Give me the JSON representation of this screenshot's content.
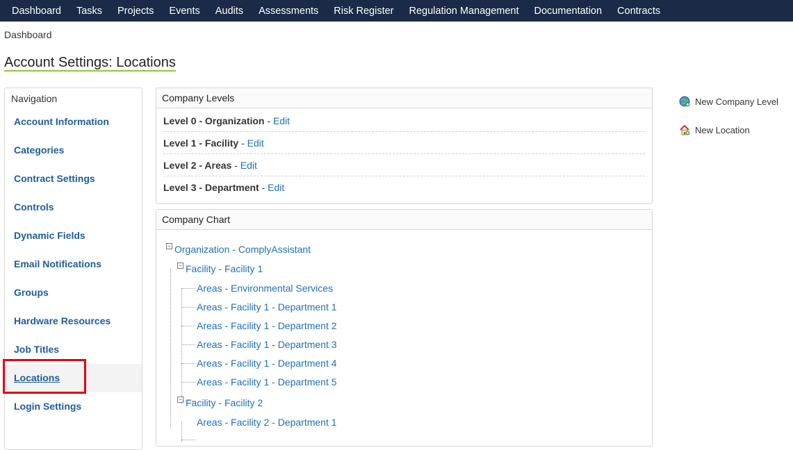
{
  "topnav": [
    "Dashboard",
    "Tasks",
    "Projects",
    "Events",
    "Audits",
    "Assessments",
    "Risk Register",
    "Regulation Management",
    "Documentation",
    "Contracts"
  ],
  "breadcrumb": "Dashboard",
  "page_title": "Account Settings: Locations",
  "sidenav": {
    "heading": "Navigation",
    "items": [
      "Account Information",
      "Categories",
      "Contract Settings",
      "Controls",
      "Dynamic Fields",
      "Email Notifications",
      "Groups",
      "Hardware Resources",
      "Job Titles",
      "Locations",
      "Login Settings"
    ],
    "active": "Locations"
  },
  "levels": {
    "heading": "Company Levels",
    "edit_label": "Edit",
    "separator": "-",
    "rows": [
      "Level 0 - Organization",
      "Level 1 - Facility",
      "Level 2 - Areas",
      "Level 3 - Department"
    ]
  },
  "chart": {
    "heading": "Company Chart",
    "toggle_glyph": "−",
    "nodes": {
      "org": "Organization - ComplyAssistant",
      "fac1": "Facility - Facility 1",
      "fac1_children": [
        "Areas - Environmental Services",
        "Areas - Facility 1 - Department 1",
        "Areas - Facility 1 - Department 2",
        "Areas - Facility 1 - Department 3",
        "Areas - Facility 1 - Department 4",
        "Areas - Facility 1 - Department 5"
      ],
      "fac2": "Facility - Facility 2",
      "fac2_children": [
        "Areas - Facility 2 - Department 1"
      ]
    }
  },
  "actions": {
    "new_level": "New Company Level",
    "new_location": "New Location"
  },
  "colors": {
    "topnav_bg": "#1b2a47",
    "link": "#1f6fb8",
    "nav_link": "#1f5c99",
    "title_underline": "#8dc63f",
    "highlight": "#e3000f"
  }
}
